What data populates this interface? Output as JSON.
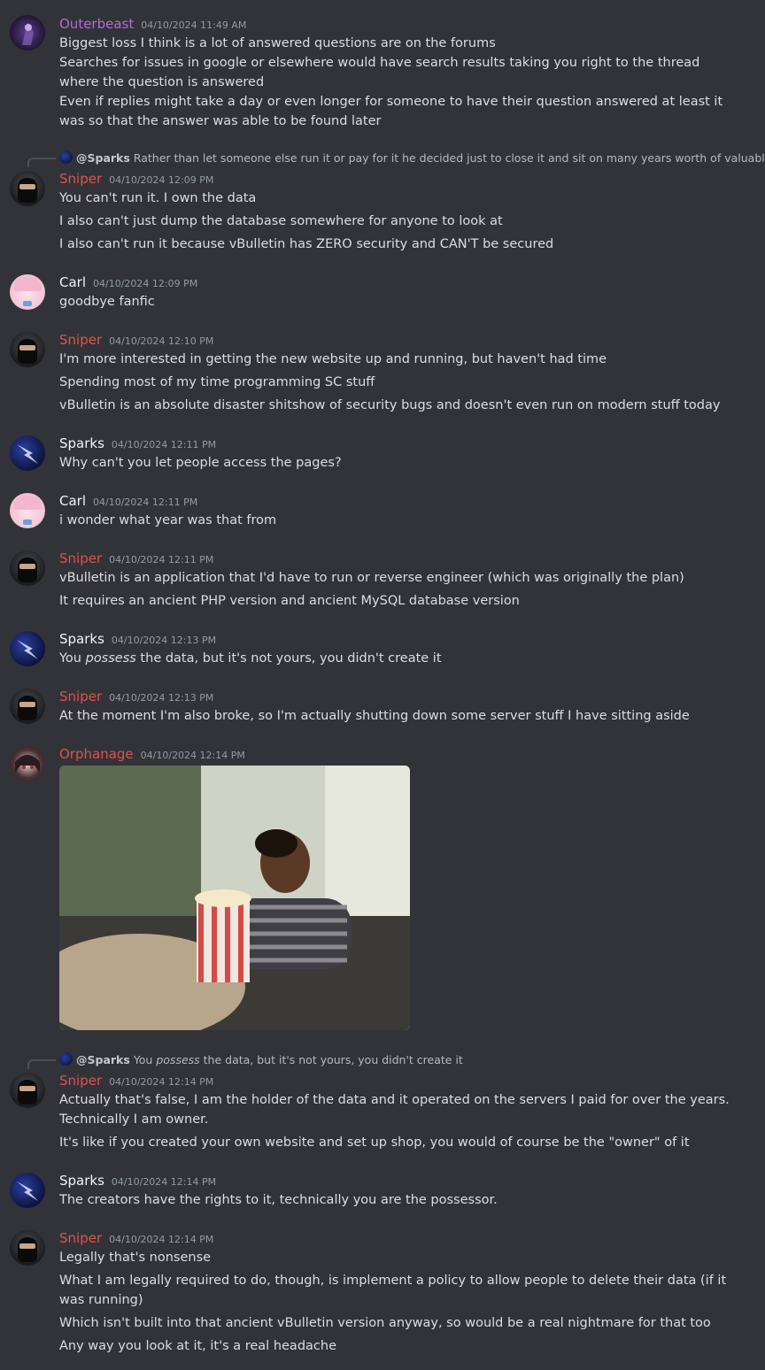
{
  "colors": {
    "background": "#313338",
    "text": "#dbdee1",
    "timestamp": "#949ba4",
    "sniper": "#e0524f",
    "outerbeast": "#b46bd6",
    "orphanage": "#e0524f",
    "default_name": "#f2f3f5"
  },
  "messages": [
    {
      "author": "Outerbeast",
      "timestamp": "04/10/2024 11:49 AM",
      "lines": [
        "Biggest loss I think is a lot of answered questions are on the forums",
        "Searches for issues in google or elsewhere would have search results taking you right to the thread where the question is answered",
        "Even if replies might take a day or even longer for someone to have their question answered at least it was so that the answer was able to be found later"
      ]
    },
    {
      "reply": {
        "mention": "@Sparks",
        "text": "Rather than let someone else run it or pay for it he decided just to close it and sit on many years worth of valuable ..."
      },
      "author": "Sniper",
      "timestamp": "04/10/2024 12:09 PM",
      "lines": [
        "You can't run it. I own the data",
        "I also can't just dump the database somewhere for anyone to look at",
        "I also can't run it because vBulletin has ZERO security and CAN'T be secured"
      ]
    },
    {
      "author": "Carl",
      "timestamp": "04/10/2024 12:09 PM",
      "lines": [
        "goodbye fanfic"
      ]
    },
    {
      "author": "Sniper",
      "timestamp": "04/10/2024 12:10 PM",
      "lines": [
        "I'm more interested in getting the new website up and running, but haven't had time",
        "Spending most of my time programming SC stuff",
        "vBulletin is an absolute disaster shitshow of security bugs and doesn't even run on modern stuff today"
      ]
    },
    {
      "author": "Sparks",
      "timestamp": "04/10/2024 12:11 PM",
      "lines": [
        "Why can't you let people access the pages?"
      ]
    },
    {
      "author": "Carl",
      "timestamp": "04/10/2024 12:11 PM",
      "lines": [
        "i wonder what year was that from"
      ]
    },
    {
      "author": "Sniper",
      "timestamp": "04/10/2024 12:11 PM",
      "lines": [
        "vBulletin is an application that I'd have to run or reverse engineer (which was originally the plan)",
        "It requires an ancient PHP version and ancient MySQL database version"
      ]
    },
    {
      "author": "Sparks",
      "timestamp": "04/10/2024 12:13 PM",
      "line_parts": [
        "You ",
        "possess",
        " the data, but it's not yours, you didn't create it"
      ]
    },
    {
      "author": "Sniper",
      "timestamp": "04/10/2024 12:13 PM",
      "lines": [
        "At the moment I'm also broke, so I'm actually shutting down some server stuff I have sitting aside"
      ]
    },
    {
      "author": "Orphanage",
      "timestamp": "04/10/2024 12:14 PM",
      "attachment": "popcorn-gif"
    },
    {
      "reply": {
        "mention": "@Sparks",
        "text_parts": [
          "You ",
          "possess",
          " the data, but it's not yours, you didn't create it"
        ]
      },
      "author": "Sniper",
      "timestamp": "04/10/2024 12:14 PM",
      "lines": [
        "Actually that's false, I am the holder of the data and it operated on the servers I paid for over the years. Technically I am owner.",
        "It's like if you created your own website and set up shop, you would of course be the \"owner\" of it"
      ]
    },
    {
      "author": "Sparks",
      "timestamp": "04/10/2024 12:14 PM",
      "lines": [
        "The creators have the rights to it, technically you are the possessor."
      ]
    },
    {
      "author": "Sniper",
      "timestamp": "04/10/2024 12:14 PM",
      "lines": [
        "Legally that's nonsense",
        "What I am legally required to do, though, is implement a policy to allow people to delete their data (if it was running)",
        "Which isn't built into that ancient vBulletin version anyway, so would be  a real nightmare for that too",
        "Any way you look at it, it's a real headache"
      ]
    }
  ]
}
